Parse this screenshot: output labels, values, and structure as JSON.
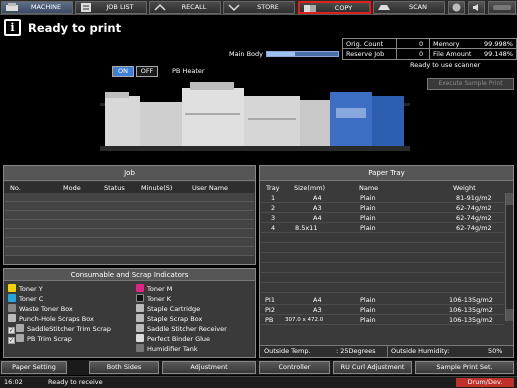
{
  "tabs": {
    "machine": "MACHINE",
    "job_list": "JOB LIST",
    "recall": "RECALL",
    "store": "STORE",
    "copy": "COPY",
    "scan": "SCAN"
  },
  "header": {
    "status_icon": "i",
    "title": "Ready to print",
    "main_body_label": "Main Body",
    "main_body_level": 0.4
  },
  "counters": {
    "orig_count_label": "Orig. Count",
    "orig_count_value": "0",
    "reserve_job_label": "Reserve Job",
    "reserve_job_value": "0",
    "memory_label": "Memory",
    "memory_value": "99.998%",
    "file_amount_label": "File Amount",
    "file_amount_value": "99.148%"
  },
  "scanner_status": "Ready to use scanner",
  "execute_sample_print": "Execute Sample Print",
  "pb_heater": {
    "on": "ON",
    "off": "OFF",
    "label": "PB Heater"
  },
  "job_panel": {
    "title": "Job",
    "columns": [
      "No.",
      "Mode",
      "Status",
      "Minute(S)",
      "User Name"
    ]
  },
  "consumables": {
    "title": "Consumable and Scrap Indicators",
    "left": [
      "Toner Y",
      "Toner C",
      "Waste Toner Box",
      "Punch-Hole Scraps Box",
      "SaddleStitcher Trim Scrap",
      "PB Trim Scrap"
    ],
    "right": [
      "Toner M",
      "Toner K",
      "Staple Cartridge",
      "Staple Scrap Box",
      "Saddle Stitcher Receiver",
      "Perfect Binder Glue",
      "Humidifier Tank"
    ]
  },
  "paper_tray": {
    "title": "Paper Tray",
    "columns": [
      "Tray",
      "Size(mm)",
      "Name",
      "Weight"
    ],
    "rows": [
      {
        "tray": "1",
        "size": "A4",
        "name": "Plain",
        "weight": "81-91g/m2"
      },
      {
        "tray": "2",
        "size": "A3",
        "name": "Plain",
        "weight": "62-74g/m2"
      },
      {
        "tray": "3",
        "size": "A4",
        "name": "Plain",
        "weight": "62-74g/m2"
      },
      {
        "tray": "4",
        "size": "8.5x11",
        "name": "Plain",
        "weight": "62-74g/m2"
      }
    ],
    "bottom_rows": [
      {
        "tray": "PI1",
        "size": "A4",
        "name": "Plain",
        "weight": "106-135g/m2"
      },
      {
        "tray": "PI2",
        "size": "A3",
        "name": "Plain",
        "weight": "106-135g/m2"
      },
      {
        "tray": "PB",
        "size": "307.0 x 472.0",
        "name": "Plain",
        "weight": "106-135g/m2"
      }
    ],
    "outside_temp_label": "Outside Temp.",
    "outside_temp_value": ": 25Degrees",
    "outside_humidity_label": "Outside Humidity:",
    "outside_humidity_value": "50%"
  },
  "bottom_buttons": {
    "paper_setting": "Paper Setting",
    "both_sides": "Both Sides",
    "adjustment": "Adjustment",
    "controller": "Controller",
    "ru_curl": "RU Curl Adjustment",
    "sample_print": "Sample Print Set."
  },
  "statusbar": {
    "time": "16:02",
    "message": "Ready to receive",
    "badge": "Drum/Dev."
  },
  "colors": {
    "accent_blue": "#3f7fd8",
    "copy_highlight": "#e0201c",
    "badge_red": "#c0302a"
  }
}
